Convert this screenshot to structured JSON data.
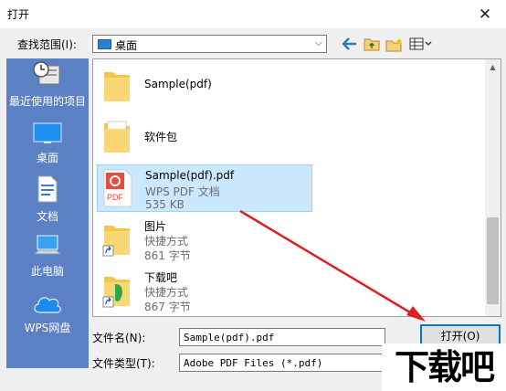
{
  "window": {
    "title": "打开",
    "close_glyph": "✕"
  },
  "toolbar": {
    "lookin_label": "查找范围(I):",
    "lookin_value": "桌面",
    "back_icon": "back-arrow-icon",
    "up_icon": "up-folder-icon",
    "newfolder_icon": "new-folder-icon",
    "view_icon": "view-menu-icon"
  },
  "places": [
    {
      "label": "最近使用的项目",
      "icon": "recent-items-icon"
    },
    {
      "label": "桌面",
      "icon": "desktop-icon"
    },
    {
      "label": "文档",
      "icon": "documents-icon"
    },
    {
      "label": "此电脑",
      "icon": "this-pc-icon"
    },
    {
      "label": "WPS网盘",
      "icon": "wps-cloud-icon"
    }
  ],
  "files": [
    {
      "name": "Sample(pdf)",
      "type": "",
      "size": "",
      "kind": "folder",
      "selected": false
    },
    {
      "name": "软件包",
      "type": "",
      "size": "",
      "kind": "folder",
      "selected": false
    },
    {
      "name": "Sample(pdf).pdf",
      "type": "WPS PDF 文档",
      "size": "535 KB",
      "kind": "pdf",
      "selected": true
    },
    {
      "name": "图片",
      "type": "快捷方式",
      "size": "861 字节",
      "kind": "shortcut-folder",
      "selected": false
    },
    {
      "name": "下载吧",
      "type": "快捷方式",
      "size": "867 字节",
      "kind": "shortcut-download",
      "selected": false
    }
  ],
  "bottom": {
    "filename_label": "文件名(N):",
    "filename_value": "Sample(pdf).pdf",
    "filetype_label": "文件类型(T):",
    "filetype_value": "Adobe PDF Files (*.pdf)",
    "open_label": "打开(O)"
  },
  "watermark": "下载吧",
  "colors": {
    "accent": "#0078d7",
    "places_bg": "#5b80c4",
    "selection": "#cce8ff",
    "annotation_arrow": "#e02020"
  }
}
